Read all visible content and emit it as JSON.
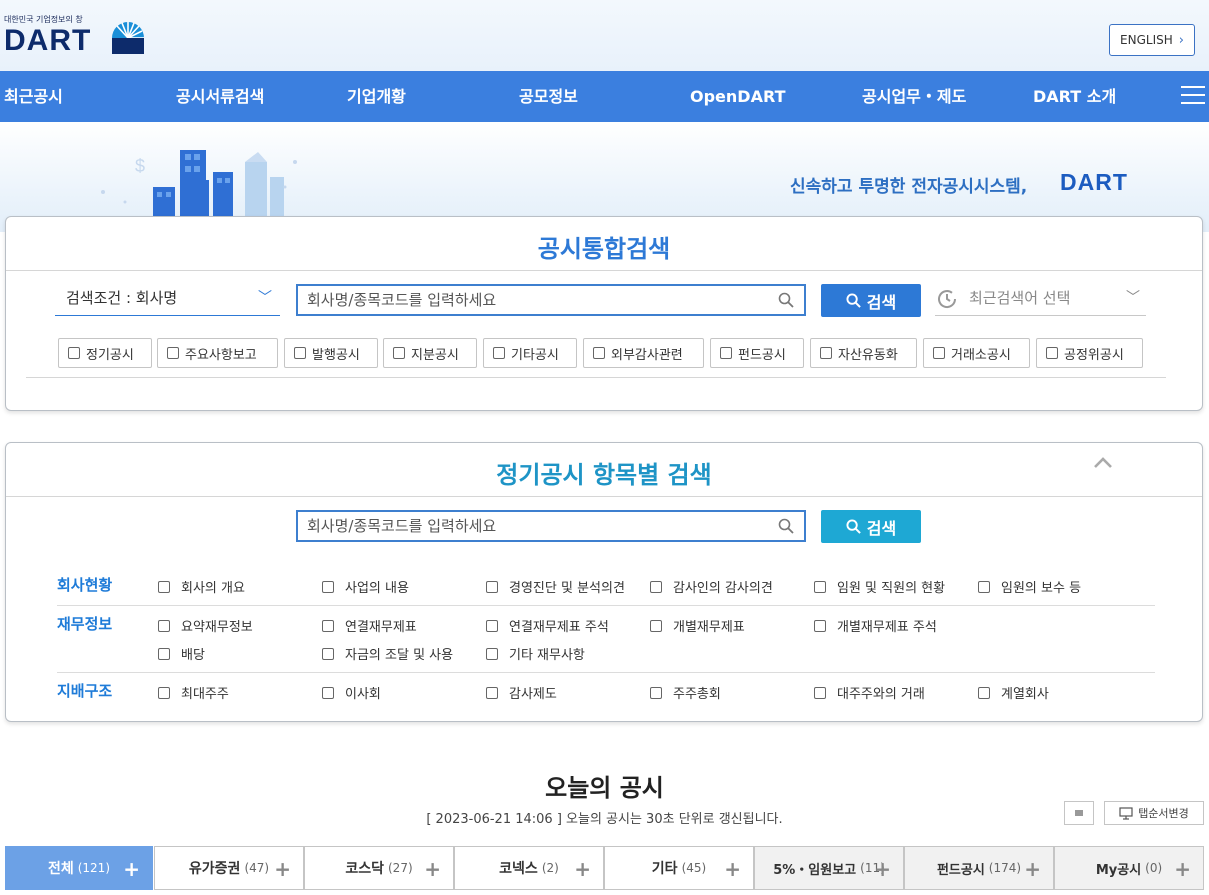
{
  "header": {
    "logo_sub": "대한민국 기업정보의 창",
    "logo_main": "DART",
    "english_label": "ENGLISH"
  },
  "nav": {
    "items": [
      "최근공시",
      "공시서류검색",
      "기업개황",
      "공모정보",
      "OpenDART",
      "공시업무・제도",
      "DART 소개"
    ]
  },
  "banner": {
    "slogan": "신속하고 투명한 전자공시시스템,",
    "slogan_logo": "DART"
  },
  "integrated_search": {
    "title": "공시통합검색",
    "condition": "검색조건 : 회사명",
    "placeholder": "회사명/종목코드를 입력하세요",
    "search_label": "검색",
    "recent_label": "최근검색어 선택",
    "filters": [
      "정기공시",
      "주요사항보고",
      "발행공시",
      "지분공시",
      "기타공시",
      "외부감사관련",
      "펀드공시",
      "자산유동화",
      "거래소공시",
      "공정위공시"
    ]
  },
  "periodic_search": {
    "title": "정기공시 항목별 검색",
    "placeholder": "회사명/종목코드를 입력하세요",
    "search_label": "검색",
    "categories": [
      {
        "label": "회사현황",
        "options": [
          "회사의 개요",
          "사업의 내용",
          "경영진단 및 분석의견",
          "감사인의 감사의견",
          "임원 및 직원의 현황",
          "임원의 보수 등"
        ]
      },
      {
        "label": "재무정보",
        "options": [
          "요약재무정보",
          "연결재무제표",
          "연결재무제표 주석",
          "개별재무제표",
          "개별재무제표 주석",
          "배당",
          "자금의 조달 및 사용",
          "기타 재무사항"
        ]
      },
      {
        "label": "지배구조",
        "options": [
          "최대주주",
          "이사회",
          "감사제도",
          "주주총회",
          "대주주와의 거래",
          "계열회사"
        ]
      }
    ]
  },
  "today": {
    "title": "오늘의 공시",
    "subtitle": "[ 2023-06-21 14:06 ] 오늘의 공시는 30초 단위로 갱신됩니다.",
    "tab_order_label": "탭순서변경",
    "tabs": [
      {
        "label": "전체",
        "count": "(121)"
      },
      {
        "label": "유가증권",
        "count": "(47)"
      },
      {
        "label": "코스닥",
        "count": "(27)"
      },
      {
        "label": "코넥스",
        "count": "(2)"
      },
      {
        "label": "기타",
        "count": "(45)"
      },
      {
        "label": "5%・임원보고",
        "count": "(11)"
      },
      {
        "label": "펀드공시",
        "count": "(174)"
      },
      {
        "label": "My공시",
        "count": "(0)"
      }
    ]
  },
  "colors": {
    "nav_blue": "#3b7fdf",
    "title_blue": "#2d79d6",
    "teal": "#1e94c6",
    "active_tab": "#6ca1e6"
  }
}
